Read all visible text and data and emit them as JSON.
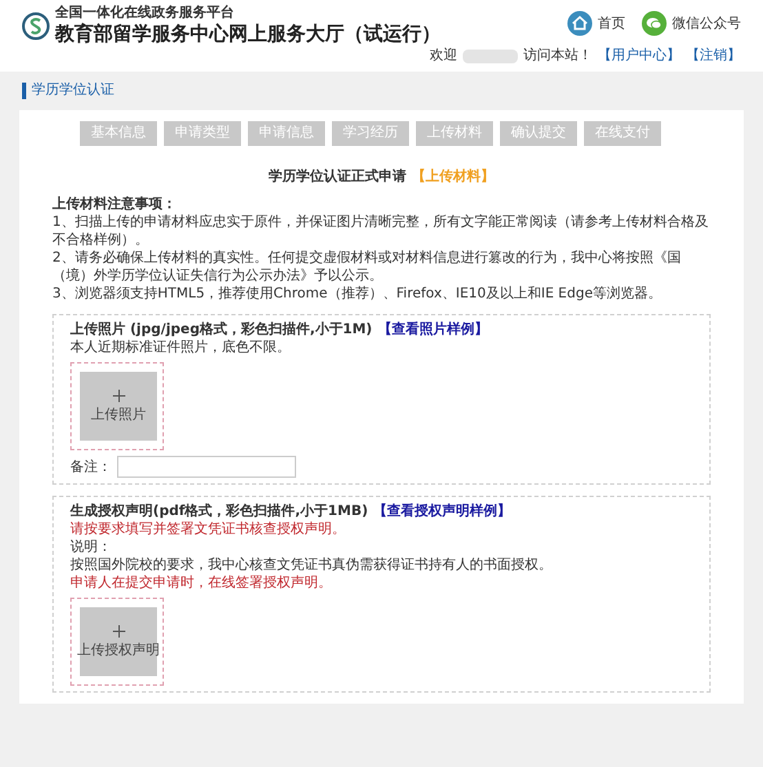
{
  "header": {
    "platform": "全国一体化在线政务服务平台",
    "title": "教育部留学服务中心网上服务大厅（试运行）",
    "nav": [
      {
        "kind": "home",
        "label": "首页"
      },
      {
        "kind": "wechat",
        "label": "微信公众号"
      }
    ],
    "welcome_before": "欢迎",
    "welcome_after": "访问本站！",
    "user_links": [
      "【用户中心】",
      "【注销】"
    ]
  },
  "section_title": "学历学位认证",
  "steps": [
    {
      "label": "基本信息",
      "selected": false
    },
    {
      "label": "申请类型",
      "selected": false
    },
    {
      "label": "申请信息",
      "selected": false
    },
    {
      "label": "学习经历",
      "selected": false
    },
    {
      "label": "上传材料",
      "selected": false
    },
    {
      "label": "确认提交",
      "selected": false
    },
    {
      "label": "在线支付",
      "selected": false
    }
  ],
  "form_title": "学历学位认证正式申请",
  "form_stage": "【上传材料】",
  "notes_title": "上传材料注意事项：",
  "notes": [
    "1、扫描上传的申请材料应忠实于原件，并保证图片清晰完整，所有文字能正常阅读（请参考上传材料合格及不合格样例）。",
    "2、请务必确保上传材料的真实性。任何提交虚假材料或对材料信息进行篡改的行为，我中心将按照《国（境）外学历学位认证失信行为公示办法》予以公示。",
    "3、浏览器须支持HTML5，推荐使用Chrome（推荐）、Firefox、IE10及以上和IE Edge等浏览器。"
  ],
  "uploads": [
    {
      "title": "上传照片 (jpg/jpeg格式，彩色扫描件,小于1M)",
      "link": "【查看照片样例】",
      "lines": [
        {
          "kind": "normal",
          "text": "本人近期标准证件照片，底色不限。"
        }
      ],
      "button": "上传照片",
      "remark_label": "备注："
    },
    {
      "title": "生成授权声明(pdf格式，彩色扫描件,小于1MB)",
      "link": "【查看授权声明样例】",
      "lines": [
        {
          "kind": "warning",
          "text": "请按要求填写并签署文凭证书核查授权声明。"
        },
        {
          "kind": "normal",
          "text": "说明："
        },
        {
          "kind": "normal",
          "text": "按照国外院校的要求，我中心核查文凭证书真伪需获得证书持有人的书面授权。"
        },
        {
          "kind": "warning",
          "text": "申请人在提交申请时，在线签署授权声明。"
        }
      ],
      "button": "上传授权声明"
    }
  ]
}
